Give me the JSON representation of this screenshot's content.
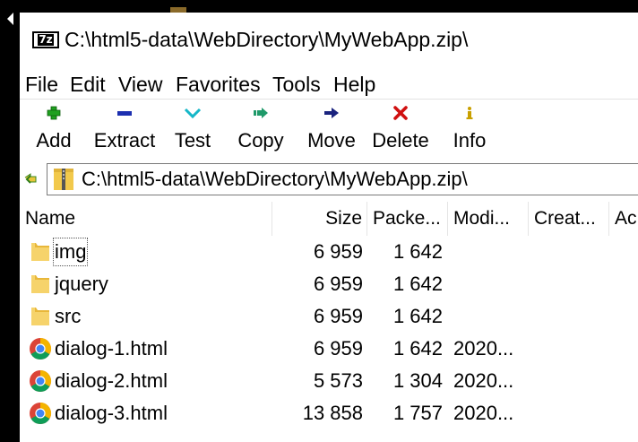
{
  "window": {
    "title": "C:\\html5-data\\WebDirectory\\MyWebApp.zip\\",
    "app_logo": "7z"
  },
  "menu": [
    "File",
    "Edit",
    "View",
    "Favorites",
    "Tools",
    "Help"
  ],
  "toolbar": [
    {
      "label": "Add",
      "icon": "add-icon",
      "color": "#1fa01f"
    },
    {
      "label": "Extract",
      "icon": "extract-icon",
      "color": "#1c2fb0"
    },
    {
      "label": "Test",
      "icon": "test-icon",
      "color": "#16b7c8"
    },
    {
      "label": "Copy",
      "icon": "copy-icon",
      "color": "#1f9a6a"
    },
    {
      "label": "Move",
      "icon": "move-icon",
      "color": "#1a237e"
    },
    {
      "label": "Delete",
      "icon": "delete-icon",
      "color": "#d01010"
    },
    {
      "label": "Info",
      "icon": "info-icon",
      "color": "#c9a000"
    }
  ],
  "address": {
    "path": "C:\\html5-data\\WebDirectory\\MyWebApp.zip\\"
  },
  "columns": {
    "name": "Name",
    "size": "Size",
    "packed": "Packe...",
    "modified": "Modi...",
    "created": "Creat...",
    "accessed": "Ac"
  },
  "files": [
    {
      "name": "img",
      "type": "folder",
      "size": "6 959",
      "packed": "1 642",
      "modified": ""
    },
    {
      "name": "jquery",
      "type": "folder",
      "size": "6 959",
      "packed": "1 642",
      "modified": ""
    },
    {
      "name": "src",
      "type": "folder",
      "size": "6 959",
      "packed": "1 642",
      "modified": ""
    },
    {
      "name": "dialog-1.html",
      "type": "html",
      "size": "6 959",
      "packed": "1 642",
      "modified": "2020..."
    },
    {
      "name": "dialog-2.html",
      "type": "html",
      "size": "5 573",
      "packed": "1 304",
      "modified": "2020..."
    },
    {
      "name": "dialog-3.html",
      "type": "html",
      "size": "13 858",
      "packed": "1 757",
      "modified": "2020..."
    }
  ]
}
